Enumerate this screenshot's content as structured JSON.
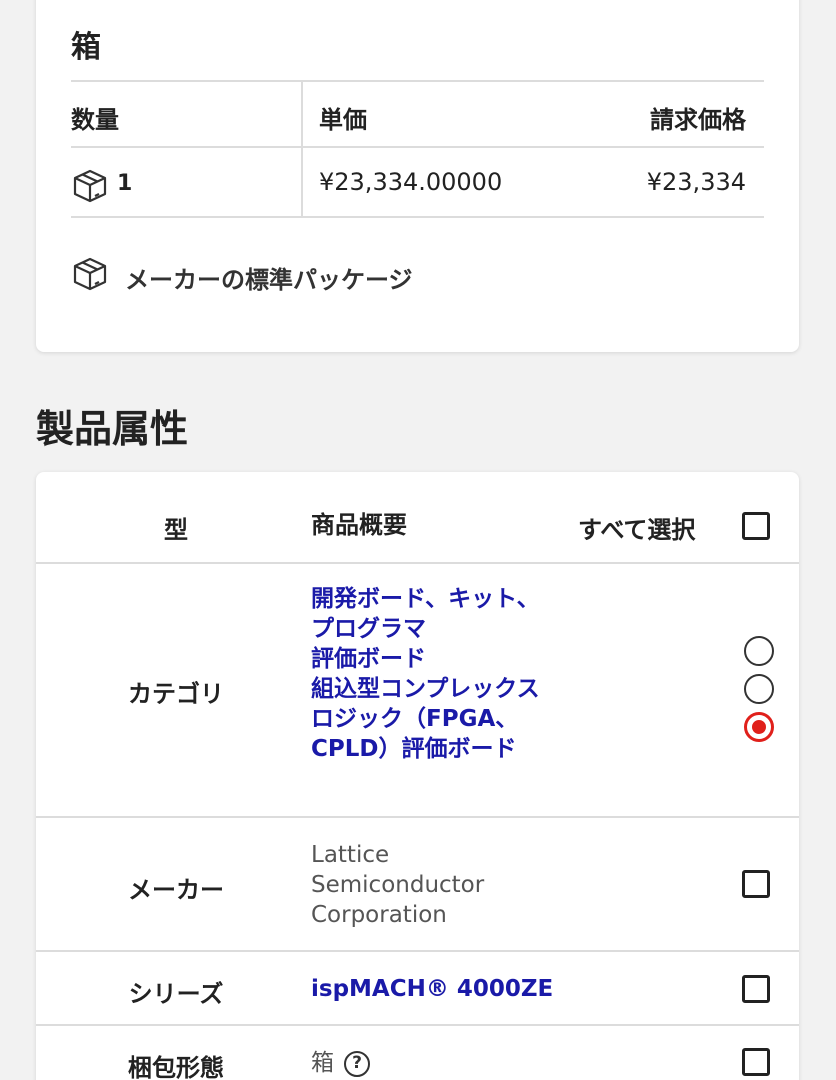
{
  "pricing": {
    "title": "箱",
    "headers": {
      "qty": "数量",
      "unit_price": "単価",
      "total": "請求価格"
    },
    "row": {
      "qty": "1",
      "unit_price": "¥23,334.00000",
      "total": "¥23,334"
    },
    "package_note": "メーカーの標準パッケージ",
    "box_icon": "box-icon"
  },
  "attributes": {
    "heading": "製品属性",
    "header": {
      "type": "型",
      "summary": "商品概要",
      "select_all": "すべて選択"
    },
    "rows": [
      {
        "type": "カテゴリ",
        "values": [
          "開発ボード、キット、プログラマ",
          "評価ボード",
          "組込型コンプレックスロジック（FPGA、CPLD）評価ボード"
        ],
        "control": "radio",
        "selected_index": 2
      },
      {
        "type": "メーカー",
        "value": "Lattice Semiconductor Corporation",
        "control": "checkbox"
      },
      {
        "type": "シリーズ",
        "value": "ispMACH® 4000ZE",
        "control": "checkbox"
      },
      {
        "type": "梱包形態",
        "value": "箱",
        "help_icon": "?",
        "control": "checkbox"
      }
    ]
  },
  "colors": {
    "link": "#1a1aa8",
    "radio_selected": "#e0201b",
    "border": "#dcdcdc"
  }
}
